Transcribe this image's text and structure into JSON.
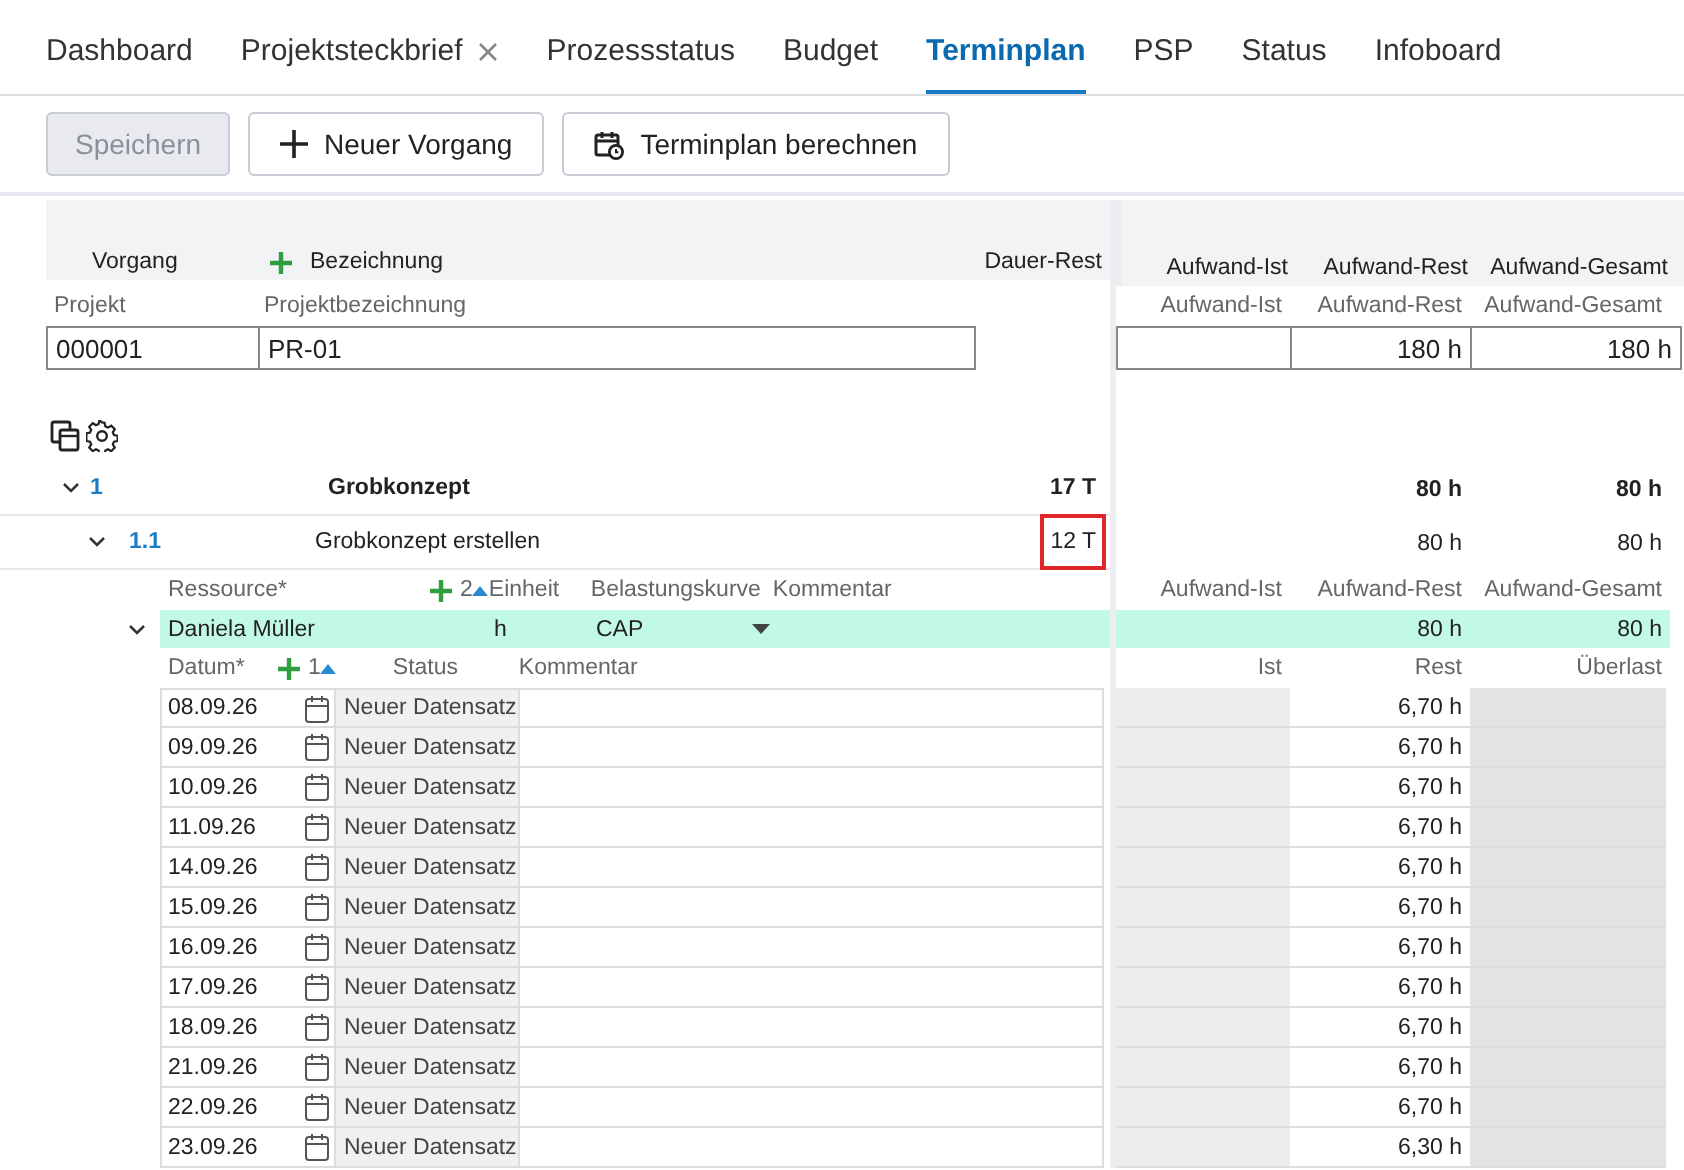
{
  "tabs": [
    {
      "label": "Dashboard",
      "selected": false,
      "closable": false
    },
    {
      "label": "Projektsteckbrief",
      "selected": false,
      "closable": true
    },
    {
      "label": "Prozessstatus",
      "selected": false,
      "closable": false
    },
    {
      "label": "Budget",
      "selected": false,
      "closable": false
    },
    {
      "label": "Terminplan",
      "selected": true,
      "closable": false
    },
    {
      "label": "PSP",
      "selected": false,
      "closable": false
    },
    {
      "label": "Status",
      "selected": false,
      "closable": false
    },
    {
      "label": "Infoboard",
      "selected": false,
      "closable": false
    }
  ],
  "toolbar": [
    {
      "label": "Speichern",
      "kind": "plain",
      "disabled": true
    },
    {
      "label": "Neuer Vorgang",
      "kind": "add",
      "disabled": false
    },
    {
      "label": "Terminplan berechnen",
      "kind": "schedule",
      "disabled": false
    }
  ],
  "header": {
    "task": "Vorgang",
    "name": "Bezeichnung",
    "duration": "Dauer-Rest",
    "effort_actual": "Aufwand-Ist",
    "effort_remaining": "Aufwand-Rest",
    "effort_total": "Aufwand-Gesamt"
  },
  "project": {
    "labels": {
      "project": "Projekt",
      "name": "Projektbezeichnung",
      "effort_actual": "Aufwand-Ist",
      "effort_remaining": "Aufwand-Rest",
      "effort_total": "Aufwand-Gesamt"
    },
    "values": {
      "project": "000001",
      "name": "PR-01",
      "effort_remaining": "180 h",
      "effort_total": "180 h"
    }
  },
  "tasks": [
    {
      "number": "1",
      "name": "Grobkonzept",
      "duration": "17 T",
      "effort_remaining": "80 h",
      "effort_total": "80 h",
      "summary": true,
      "expanded": true,
      "highlighted": false,
      "children": [
        {
          "number": "1.1",
          "name": "Grobkonzept erstellen",
          "duration": "12 T",
          "effort_remaining": "80 h",
          "effort_total": "80 h",
          "summary": false,
          "expanded": true,
          "highlighted": true,
          "resources": {
            "columns": {
              "resource": "Ressource*",
              "count": "2",
              "unit": "Einheit",
              "curve": "Belastungskurve",
              "comment": "Kommentar",
              "effort_actual": "Aufwand-Ist",
              "effort_remaining": "Aufwand-Rest",
              "effort_total": "Aufwand-Gesamt"
            },
            "items": [
              {
                "name": "Daniela Müller",
                "unit": "h",
                "curve": "CAP",
                "effort_remaining": "80 h",
                "effort_total": "80 h",
                "expanded": true,
                "entry_columns": {
                  "date": "Datum*",
                  "count": "1",
                  "status": "Status",
                  "comment": "Kommentar",
                  "actual": "Ist",
                  "remaining": "Rest",
                  "overload": "Überlast"
                },
                "entries": [
                  {
                    "date": "08.09.26",
                    "status": "Neuer Datensatz",
                    "remaining": "6,70 h"
                  },
                  {
                    "date": "09.09.26",
                    "status": "Neuer Datensatz",
                    "remaining": "6,70 h"
                  },
                  {
                    "date": "10.09.26",
                    "status": "Neuer Datensatz",
                    "remaining": "6,70 h"
                  },
                  {
                    "date": "11.09.26",
                    "status": "Neuer Datensatz",
                    "remaining": "6,70 h"
                  },
                  {
                    "date": "14.09.26",
                    "status": "Neuer Datensatz",
                    "remaining": "6,70 h"
                  },
                  {
                    "date": "15.09.26",
                    "status": "Neuer Datensatz",
                    "remaining": "6,70 h"
                  },
                  {
                    "date": "16.09.26",
                    "status": "Neuer Datensatz",
                    "remaining": "6,70 h"
                  },
                  {
                    "date": "17.09.26",
                    "status": "Neuer Datensatz",
                    "remaining": "6,70 h"
                  },
                  {
                    "date": "18.09.26",
                    "status": "Neuer Datensatz",
                    "remaining": "6,70 h"
                  },
                  {
                    "date": "21.09.26",
                    "status": "Neuer Datensatz",
                    "remaining": "6,70 h"
                  },
                  {
                    "date": "22.09.26",
                    "status": "Neuer Datensatz",
                    "remaining": "6,70 h"
                  },
                  {
                    "date": "23.09.26",
                    "status": "Neuer Datensatz",
                    "remaining": "6,30 h"
                  }
                ]
              }
            ]
          }
        }
      ]
    }
  ]
}
